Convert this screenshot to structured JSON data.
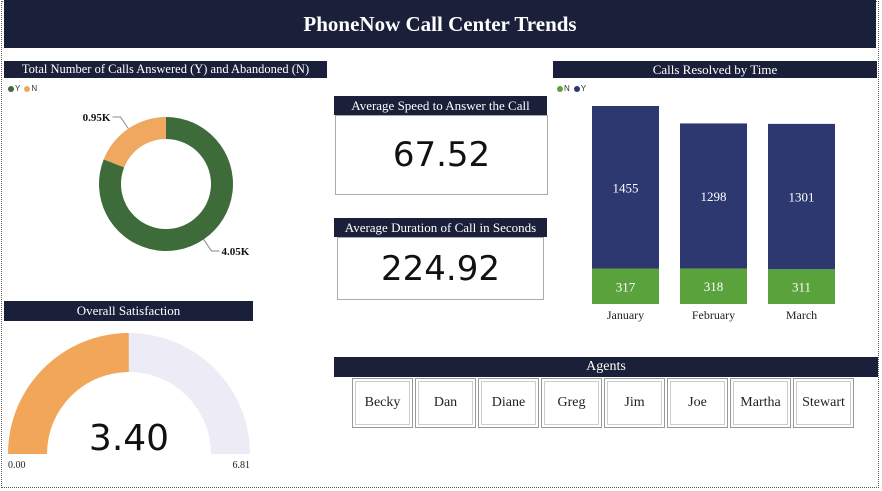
{
  "dashboard": {
    "title": "PhoneNow Call Center Trends"
  },
  "donut": {
    "title": "Total Number of Calls Answered (Y) and Abandoned (N)",
    "legend": [
      {
        "label": "Y",
        "color": "#3e6b3a"
      },
      {
        "label": "N",
        "color": "#f0a860"
      }
    ]
  },
  "speed": {
    "title": "Average Speed to Answer the Call",
    "value": "67.52"
  },
  "duration": {
    "title": "Average Duration of Call in Seconds",
    "value": "224.92"
  },
  "satisfaction": {
    "title": "Overall Satisfaction",
    "value": "3.40",
    "min_label": "0.00",
    "max_label": "6.81"
  },
  "resolved": {
    "title": "Calls Resolved by Time",
    "legend": [
      {
        "label": "N",
        "color": "#5aa33c"
      },
      {
        "label": "Y",
        "color": "#2d3870"
      }
    ]
  },
  "agents": {
    "title": "Agents",
    "names": [
      "Becky",
      "Dan",
      "Diane",
      "Greg",
      "Jim",
      "Joe",
      "Martha",
      "Stewart"
    ]
  },
  "chart_data": [
    {
      "type": "pie",
      "title": "Total Number of Calls Answered (Y) and Abandoned (N)",
      "categories": [
        "Y",
        "N"
      ],
      "values": [
        4050,
        950
      ],
      "labels": [
        "4.05K",
        "0.95K"
      ],
      "colors": [
        "#3e6b3a",
        "#f0a860"
      ]
    },
    {
      "type": "bar",
      "title": "Calls Resolved by Time",
      "categories": [
        "January",
        "February",
        "March"
      ],
      "series": [
        {
          "name": "N",
          "values": [
            317,
            318,
            311
          ],
          "color": "#5aa33c"
        },
        {
          "name": "Y",
          "values": [
            1455,
            1298,
            1301
          ],
          "color": "#2d3870"
        }
      ],
      "stacked": true
    },
    {
      "type": "gauge",
      "title": "Overall Satisfaction",
      "value": 3.4,
      "min": 0,
      "max": 6.81,
      "colors": {
        "fill": "#f2a65a",
        "track": "#edecf6"
      }
    }
  ]
}
